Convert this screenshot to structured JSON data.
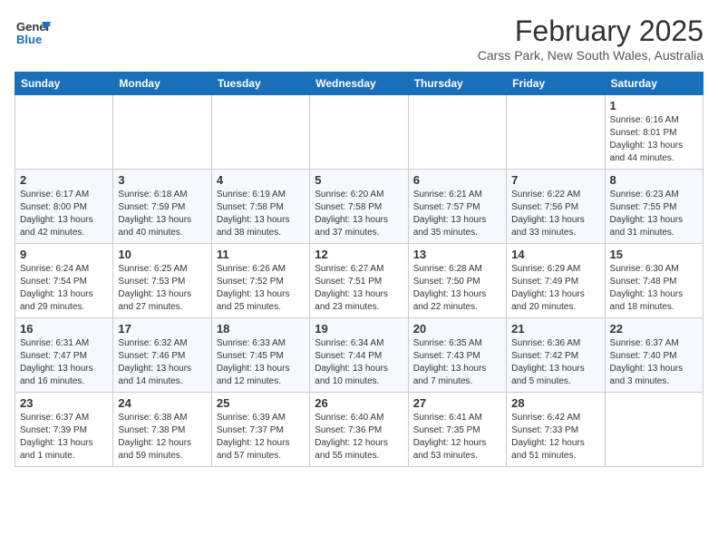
{
  "header": {
    "logo_general": "General",
    "logo_blue": "Blue",
    "month_title": "February 2025",
    "location": "Carss Park, New South Wales, Australia"
  },
  "weekdays": [
    "Sunday",
    "Monday",
    "Tuesday",
    "Wednesday",
    "Thursday",
    "Friday",
    "Saturday"
  ],
  "weeks": [
    [
      {
        "day": "",
        "info": ""
      },
      {
        "day": "",
        "info": ""
      },
      {
        "day": "",
        "info": ""
      },
      {
        "day": "",
        "info": ""
      },
      {
        "day": "",
        "info": ""
      },
      {
        "day": "",
        "info": ""
      },
      {
        "day": "1",
        "info": "Sunrise: 6:16 AM\nSunset: 8:01 PM\nDaylight: 13 hours\nand 44 minutes."
      }
    ],
    [
      {
        "day": "2",
        "info": "Sunrise: 6:17 AM\nSunset: 8:00 PM\nDaylight: 13 hours\nand 42 minutes."
      },
      {
        "day": "3",
        "info": "Sunrise: 6:18 AM\nSunset: 7:59 PM\nDaylight: 13 hours\nand 40 minutes."
      },
      {
        "day": "4",
        "info": "Sunrise: 6:19 AM\nSunset: 7:58 PM\nDaylight: 13 hours\nand 38 minutes."
      },
      {
        "day": "5",
        "info": "Sunrise: 6:20 AM\nSunset: 7:58 PM\nDaylight: 13 hours\nand 37 minutes."
      },
      {
        "day": "6",
        "info": "Sunrise: 6:21 AM\nSunset: 7:57 PM\nDaylight: 13 hours\nand 35 minutes."
      },
      {
        "day": "7",
        "info": "Sunrise: 6:22 AM\nSunset: 7:56 PM\nDaylight: 13 hours\nand 33 minutes."
      },
      {
        "day": "8",
        "info": "Sunrise: 6:23 AM\nSunset: 7:55 PM\nDaylight: 13 hours\nand 31 minutes."
      }
    ],
    [
      {
        "day": "9",
        "info": "Sunrise: 6:24 AM\nSunset: 7:54 PM\nDaylight: 13 hours\nand 29 minutes."
      },
      {
        "day": "10",
        "info": "Sunrise: 6:25 AM\nSunset: 7:53 PM\nDaylight: 13 hours\nand 27 minutes."
      },
      {
        "day": "11",
        "info": "Sunrise: 6:26 AM\nSunset: 7:52 PM\nDaylight: 13 hours\nand 25 minutes."
      },
      {
        "day": "12",
        "info": "Sunrise: 6:27 AM\nSunset: 7:51 PM\nDaylight: 13 hours\nand 23 minutes."
      },
      {
        "day": "13",
        "info": "Sunrise: 6:28 AM\nSunset: 7:50 PM\nDaylight: 13 hours\nand 22 minutes."
      },
      {
        "day": "14",
        "info": "Sunrise: 6:29 AM\nSunset: 7:49 PM\nDaylight: 13 hours\nand 20 minutes."
      },
      {
        "day": "15",
        "info": "Sunrise: 6:30 AM\nSunset: 7:48 PM\nDaylight: 13 hours\nand 18 minutes."
      }
    ],
    [
      {
        "day": "16",
        "info": "Sunrise: 6:31 AM\nSunset: 7:47 PM\nDaylight: 13 hours\nand 16 minutes."
      },
      {
        "day": "17",
        "info": "Sunrise: 6:32 AM\nSunset: 7:46 PM\nDaylight: 13 hours\nand 14 minutes."
      },
      {
        "day": "18",
        "info": "Sunrise: 6:33 AM\nSunset: 7:45 PM\nDaylight: 13 hours\nand 12 minutes."
      },
      {
        "day": "19",
        "info": "Sunrise: 6:34 AM\nSunset: 7:44 PM\nDaylight: 13 hours\nand 10 minutes."
      },
      {
        "day": "20",
        "info": "Sunrise: 6:35 AM\nSunset: 7:43 PM\nDaylight: 13 hours\nand 7 minutes."
      },
      {
        "day": "21",
        "info": "Sunrise: 6:36 AM\nSunset: 7:42 PM\nDaylight: 13 hours\nand 5 minutes."
      },
      {
        "day": "22",
        "info": "Sunrise: 6:37 AM\nSunset: 7:40 PM\nDaylight: 13 hours\nand 3 minutes."
      }
    ],
    [
      {
        "day": "23",
        "info": "Sunrise: 6:37 AM\nSunset: 7:39 PM\nDaylight: 13 hours\nand 1 minute."
      },
      {
        "day": "24",
        "info": "Sunrise: 6:38 AM\nSunset: 7:38 PM\nDaylight: 12 hours\nand 59 minutes."
      },
      {
        "day": "25",
        "info": "Sunrise: 6:39 AM\nSunset: 7:37 PM\nDaylight: 12 hours\nand 57 minutes."
      },
      {
        "day": "26",
        "info": "Sunrise: 6:40 AM\nSunset: 7:36 PM\nDaylight: 12 hours\nand 55 minutes."
      },
      {
        "day": "27",
        "info": "Sunrise: 6:41 AM\nSunset: 7:35 PM\nDaylight: 12 hours\nand 53 minutes."
      },
      {
        "day": "28",
        "info": "Sunrise: 6:42 AM\nSunset: 7:33 PM\nDaylight: 12 hours\nand 51 minutes."
      },
      {
        "day": "",
        "info": ""
      }
    ]
  ]
}
